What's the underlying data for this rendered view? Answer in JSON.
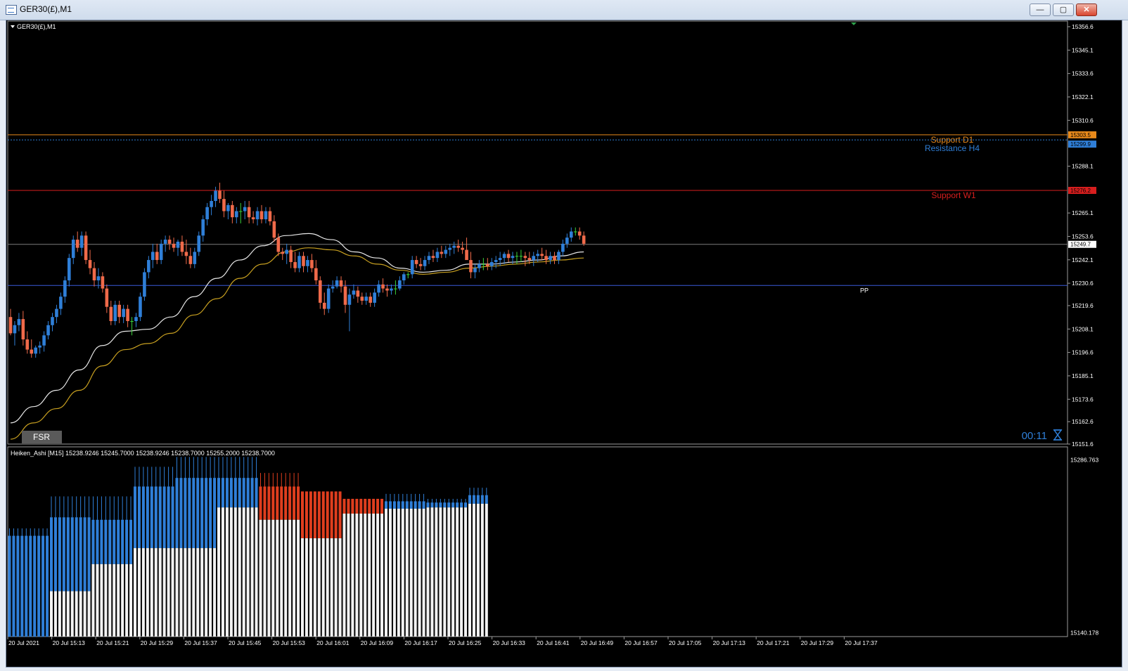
{
  "window": {
    "title": "GER30(£),M1",
    "buttons": {
      "minimize": "—",
      "maximize": "▢",
      "close": "✕"
    }
  },
  "chart": {
    "symbol_label": "GER30(£),M1",
    "fsr_label": "FSR",
    "timer": "00:11",
    "price_axis": [
      "15356.6",
      "15345.1",
      "15333.6",
      "15322.1",
      "15310.6",
      "15288.1",
      "15265.1",
      "15253.6",
      "15242.1",
      "15230.6",
      "15219.6",
      "15208.1",
      "15196.6",
      "15185.1",
      "15173.6",
      "15162.6",
      "15151.6"
    ],
    "levels": [
      {
        "name": "Support D1",
        "price": 15303.5,
        "color": "#e8891a",
        "style": "solid",
        "badge": "15303.5"
      },
      {
        "name": "Resistance H4",
        "price": 15301.0,
        "color": "#2f7fd8",
        "style": "dotted",
        "badge": "15299.9"
      },
      {
        "name": "Support W1",
        "price": 15276.2,
        "color": "#d81e1e",
        "style": "solid",
        "badge": "15276.2"
      }
    ],
    "current_price": {
      "price": 15249.7,
      "label": "15249.7"
    },
    "pp": {
      "name": "PP",
      "price": 15229.5
    }
  },
  "indicator": {
    "label": "Heiken_Ashi [M15]  15238.9246 15245.7000 15238.9246 15238.7000 15255.2000 15238.7000",
    "axis_top": "15286.763",
    "axis_bottom": "15140.178",
    "blocks": [
      {
        "n": 10,
        "hi": 15228,
        "top": 15222,
        "bot": 15140,
        "color": "#2f7fd8"
      },
      {
        "n": 10,
        "hi": 15254,
        "top": 15237,
        "bot": 15177,
        "color": "#2f7fd8"
      },
      {
        "n": 10,
        "hi": 15254,
        "top": 15235,
        "bot": 15199,
        "color": "#2f7fd8"
      },
      {
        "n": 10,
        "hi": 15278,
        "top": 15262,
        "bot": 15212,
        "color": "#2f7fd8"
      },
      {
        "n": 10,
        "hi": 15286,
        "top": 15269,
        "bot": 15212,
        "color": "#2f7fd8"
      },
      {
        "n": 10,
        "hi": 15286,
        "top": 15269,
        "bot": 15245,
        "color": "#2f7fd8"
      },
      {
        "n": 10,
        "hi": 15273,
        "top": 15262,
        "bot": 15235,
        "color": "#e03e1e"
      },
      {
        "n": 10,
        "hi": 15258,
        "top": 15258,
        "bot": 15220,
        "color": "#e03e1e"
      },
      {
        "n": 10,
        "hi": 15252,
        "top": 15252,
        "bot": 15240,
        "color": "#e03e1e"
      },
      {
        "n": 10,
        "hi": 15256,
        "top": 15250,
        "bot": 15244,
        "color": "#2f7fd8"
      },
      {
        "n": 10,
        "hi": 15252,
        "top": 15249,
        "bot": 15245,
        "color": "#2f7fd8"
      },
      {
        "n": 5,
        "hi": 15261,
        "top": 15255,
        "bot": 15248,
        "color": "#2f7fd8"
      }
    ]
  },
  "time_axis": [
    "20 Jul 2021",
    "20 Jul 15:13",
    "20 Jul 15:21",
    "20 Jul 15:29",
    "20 Jul 15:37",
    "20 Jul 15:45",
    "20 Jul 15:53",
    "20 Jul 16:01",
    "20 Jul 16:09",
    "20 Jul 16:17",
    "20 Jul 16:25",
    "20 Jul 16:33",
    "20 Jul 16:41",
    "20 Jul 16:49",
    "20 Jul 16:57",
    "20 Jul 17:05",
    "20 Jul 17:13",
    "20 Jul 17:21",
    "20 Jul 17:29",
    "20 Jul 17:37"
  ],
  "chart_data": {
    "type": "candlestick",
    "title": "GER30(£),M1",
    "ylim": [
      15151.6,
      15358.0
    ],
    "colors": {
      "bull": "#2f7fd8",
      "bear": "#f06a4a",
      "doji": "#3ad43a",
      "ma_fast": "#e8e8e8",
      "ma_slow": "#c8a020"
    },
    "candles": [
      [
        15214,
        15218,
        15205,
        15206
      ],
      [
        15206,
        15212,
        15200,
        15210
      ],
      [
        15210,
        15216,
        15207,
        15213
      ],
      [
        15213,
        15217,
        15200,
        15203
      ],
      [
        15203,
        15207,
        15196,
        15198
      ],
      [
        15198,
        15203,
        15194,
        15196
      ],
      [
        15196,
        15200,
        15194,
        15199
      ],
      [
        15199,
        15202,
        15196,
        15200
      ],
      [
        15200,
        15207,
        15197,
        15205
      ],
      [
        15205,
        15212,
        15203,
        15210
      ],
      [
        15210,
        15216,
        15207,
        15214
      ],
      [
        15214,
        15220,
        15211,
        15218
      ],
      [
        15218,
        15226,
        15215,
        15224
      ],
      [
        15224,
        15234,
        15221,
        15232
      ],
      [
        15232,
        15245,
        15229,
        15243
      ],
      [
        15243,
        15254,
        15240,
        15252
      ],
      [
        15252,
        15256,
        15246,
        15248
      ],
      [
        15248,
        15256,
        15244,
        15254
      ],
      [
        15254,
        15256,
        15240,
        15242
      ],
      [
        15242,
        15247,
        15235,
        15238
      ],
      [
        15238,
        15241,
        15229,
        15232
      ],
      [
        15232,
        15238,
        15228,
        15234
      ],
      [
        15234,
        15236,
        15226,
        15228
      ],
      [
        15228,
        15230,
        15216,
        15219
      ],
      [
        15219,
        15222,
        15210,
        15212
      ],
      [
        15212,
        15222,
        15210,
        15220
      ],
      [
        15220,
        15222,
        15211,
        15214
      ],
      [
        15214,
        15220,
        15211,
        15218
      ],
      [
        15218,
        15220,
        15209,
        15212
      ],
      [
        15212,
        15214,
        15205,
        15212
      ],
      [
        15212,
        15216,
        15209,
        15214
      ],
      [
        15214,
        15226,
        15212,
        15224
      ],
      [
        15224,
        15238,
        15222,
        15236
      ],
      [
        15236,
        15244,
        15233,
        15242
      ],
      [
        15242,
        15250,
        15238,
        15246
      ],
      [
        15246,
        15250,
        15240,
        15242
      ],
      [
        15242,
        15252,
        15240,
        15250
      ],
      [
        15250,
        15254,
        15246,
        15252
      ],
      [
        15252,
        15254,
        15247,
        15250
      ],
      [
        15250,
        15253,
        15246,
        15248
      ],
      [
        15248,
        15252,
        15244,
        15251
      ],
      [
        15251,
        15254,
        15244,
        15246
      ],
      [
        15246,
        15252,
        15240,
        15244
      ],
      [
        15244,
        15248,
        15238,
        15240
      ],
      [
        15240,
        15248,
        15238,
        15246
      ],
      [
        15246,
        15256,
        15244,
        15254
      ],
      [
        15254,
        15264,
        15251,
        15262
      ],
      [
        15262,
        15270,
        15259,
        15268
      ],
      [
        15268,
        15274,
        15264,
        15271
      ],
      [
        15271,
        15278,
        15268,
        15276
      ],
      [
        15276,
        15280,
        15270,
        15272
      ],
      [
        15272,
        15276,
        15263,
        15266
      ],
      [
        15266,
        15270,
        15262,
        15269
      ],
      [
        15269,
        15271,
        15260,
        15263
      ],
      [
        15263,
        15268,
        15260,
        15266
      ],
      [
        15266,
        15270,
        15260,
        15266
      ],
      [
        15266,
        15271,
        15262,
        15268
      ],
      [
        15268,
        15271,
        15260,
        15263
      ],
      [
        15263,
        15266,
        15260,
        15262
      ],
      [
        15262,
        15268,
        15259,
        15266
      ],
      [
        15266,
        15269,
        15260,
        15262
      ],
      [
        15262,
        15268,
        15260,
        15266
      ],
      [
        15266,
        15268,
        15259,
        15261
      ],
      [
        15261,
        15264,
        15251,
        15253
      ],
      [
        15253,
        15255,
        15244,
        15246
      ],
      [
        15246,
        15248,
        15242,
        15245
      ],
      [
        15245,
        15250,
        15240,
        15247
      ],
      [
        15247,
        15249,
        15238,
        15241
      ],
      [
        15241,
        15246,
        15236,
        15238
      ],
      [
        15238,
        15246,
        15236,
        15244
      ],
      [
        15244,
        15246,
        15236,
        15239
      ],
      [
        15239,
        15244,
        15236,
        15242
      ],
      [
        15242,
        15245,
        15236,
        15238
      ],
      [
        15238,
        15242,
        15230,
        15232
      ],
      [
        15232,
        15234,
        15218,
        15221
      ],
      [
        15221,
        15226,
        15215,
        15218
      ],
      [
        15218,
        15230,
        15216,
        15228
      ],
      [
        15228,
        15232,
        15226,
        15229
      ],
      [
        15229,
        15234,
        15228,
        15232
      ],
      [
        15232,
        15234,
        15226,
        15229
      ],
      [
        15229,
        15232,
        15216,
        15220
      ],
      [
        15220,
        15228,
        15207,
        15225
      ],
      [
        15225,
        15230,
        15223,
        15227
      ],
      [
        15227,
        15229,
        15221,
        15224
      ],
      [
        15224,
        15226,
        15220,
        15222
      ],
      [
        15222,
        15226,
        15220,
        15224
      ],
      [
        15224,
        15226,
        15219,
        15221
      ],
      [
        15221,
        15228,
        15219,
        15226
      ],
      [
        15226,
        15232,
        15224,
        15230
      ],
      [
        15230,
        15233,
        15226,
        15228
      ],
      [
        15228,
        15230,
        15224,
        15227
      ],
      [
        15227,
        15230,
        15225,
        15228
      ],
      [
        15228,
        15232,
        15225,
        15228
      ],
      [
        15228,
        15234,
        15227,
        15232
      ],
      [
        15232,
        15236,
        15230,
        15235
      ],
      [
        15235,
        15236,
        15233,
        15235
      ],
      [
        15235,
        15244,
        15233,
        15242
      ],
      [
        15242,
        15244,
        15238,
        15240
      ],
      [
        15240,
        15243,
        15237,
        15239
      ],
      [
        15239,
        15244,
        15237,
        15242
      ],
      [
        15242,
        15246,
        15240,
        15244
      ],
      [
        15244,
        15247,
        15241,
        15243
      ],
      [
        15243,
        15248,
        15241,
        15246
      ],
      [
        15246,
        15249,
        15243,
        15245
      ],
      [
        15245,
        15249,
        15243,
        15247
      ],
      [
        15247,
        15250,
        15244,
        15248
      ],
      [
        15248,
        15251,
        15245,
        15249
      ],
      [
        15249,
        15252,
        15246,
        15248
      ],
      [
        15248,
        15251,
        15245,
        15247
      ],
      [
        15247,
        15253,
        15244,
        15242
      ],
      [
        15242,
        15246,
        15233,
        15236
      ],
      [
        15236,
        15240,
        15233,
        15238
      ],
      [
        15238,
        15242,
        15236,
        15240
      ],
      [
        15240,
        15243,
        15237,
        15240
      ],
      [
        15240,
        15243,
        15237,
        15239
      ],
      [
        15239,
        15243,
        15237,
        15241
      ],
      [
        15241,
        15244,
        15238,
        15242
      ],
      [
        15242,
        15246,
        15239,
        15243
      ],
      [
        15243,
        15246,
        15240,
        15245
      ],
      [
        15245,
        15247,
        15241,
        15243
      ],
      [
        15243,
        15246,
        15240,
        15244
      ],
      [
        15244,
        15246,
        15240,
        15244
      ],
      [
        15244,
        15247,
        15241,
        15244
      ],
      [
        15244,
        15246,
        15239,
        15243
      ],
      [
        15243,
        15246,
        15240,
        15242
      ],
      [
        15242,
        15246,
        15239,
        15244
      ],
      [
        15244,
        15247,
        15241,
        15245
      ],
      [
        15245,
        15248,
        15242,
        15244
      ],
      [
        15244,
        15247,
        15240,
        15242
      ],
      [
        15242,
        15246,
        15240,
        15244
      ],
      [
        15244,
        15246,
        15240,
        15242
      ],
      [
        15242,
        15247,
        15240,
        15246
      ],
      [
        15246,
        15252,
        15244,
        15250
      ],
      [
        15250,
        15255,
        15248,
        15253
      ],
      [
        15253,
        15258,
        15251,
        15256
      ],
      [
        15256,
        15258,
        15254,
        15256
      ],
      [
        15256,
        15258,
        15252,
        15254
      ],
      [
        15254,
        15256,
        15249,
        15250
      ]
    ],
    "ma_fast": [
      15162,
      15170,
      15178,
      15188,
      15200,
      15207,
      15208,
      15214,
      15224,
      15233,
      15242,
      15249,
      15254,
      15255,
      15252,
      15246,
      15243,
      15238,
      15236,
      15237,
      15240,
      15240,
      15241,
      15242,
      15244,
      15246
    ],
    "ma_slow": [
      15154,
      15162,
      15169,
      15178,
      15190,
      15198,
      15201,
      15206,
      15215,
      15223,
      15233,
      15240,
      15246,
      15248,
      15247,
      15244,
      15240,
      15237,
      15235,
      15236,
      15238,
      15239,
      15240,
      15241,
      15242,
      15243
    ]
  }
}
